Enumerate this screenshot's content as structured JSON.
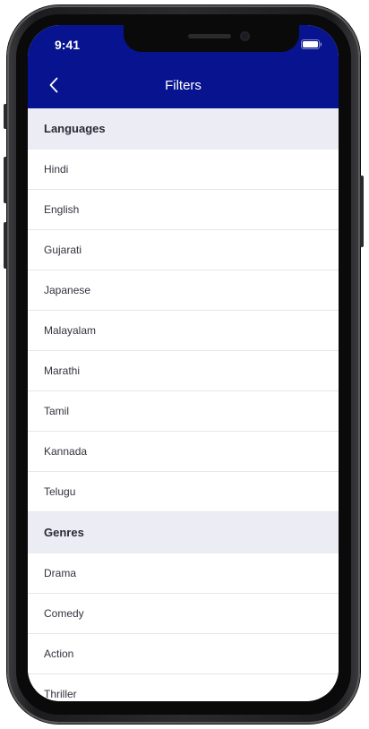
{
  "status": {
    "time": "9:41"
  },
  "header": {
    "title": "Filters"
  },
  "sections": [
    {
      "title": "Languages",
      "items": [
        "Hindi",
        "English",
        "Gujarati",
        "Japanese",
        "Malayalam",
        "Marathi",
        "Tamil",
        "Kannada",
        "Telugu"
      ]
    },
    {
      "title": "Genres",
      "items": [
        "Drama",
        "Comedy",
        "Action",
        "Thriller"
      ]
    }
  ],
  "colors": {
    "header_bg": "#08138f",
    "section_bg": "#ececf4"
  }
}
